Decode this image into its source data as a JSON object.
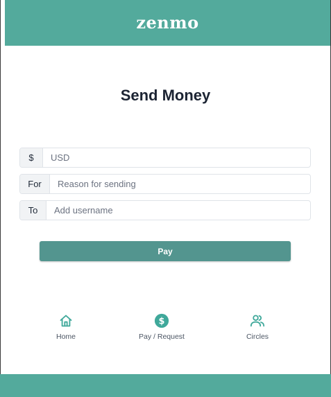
{
  "header": {
    "brand": "zenmo"
  },
  "main": {
    "title": "Send Money",
    "fields": [
      {
        "prefix": "$",
        "placeholder": "USD",
        "value": ""
      },
      {
        "prefix": "For",
        "placeholder": "Reason for sending",
        "value": ""
      },
      {
        "prefix": "To",
        "placeholder": "Add username",
        "value": ""
      }
    ],
    "pay_label": "Pay"
  },
  "nav": {
    "items": [
      {
        "label": "Home",
        "icon": "home-icon"
      },
      {
        "label": "Pay / Request",
        "icon": "dollar-circle-icon"
      },
      {
        "label": "Circles",
        "icon": "users-icon"
      }
    ]
  },
  "colors": {
    "brand": "#53aa9c",
    "button": "#53958f",
    "nav_icon": "#3fa89a"
  }
}
